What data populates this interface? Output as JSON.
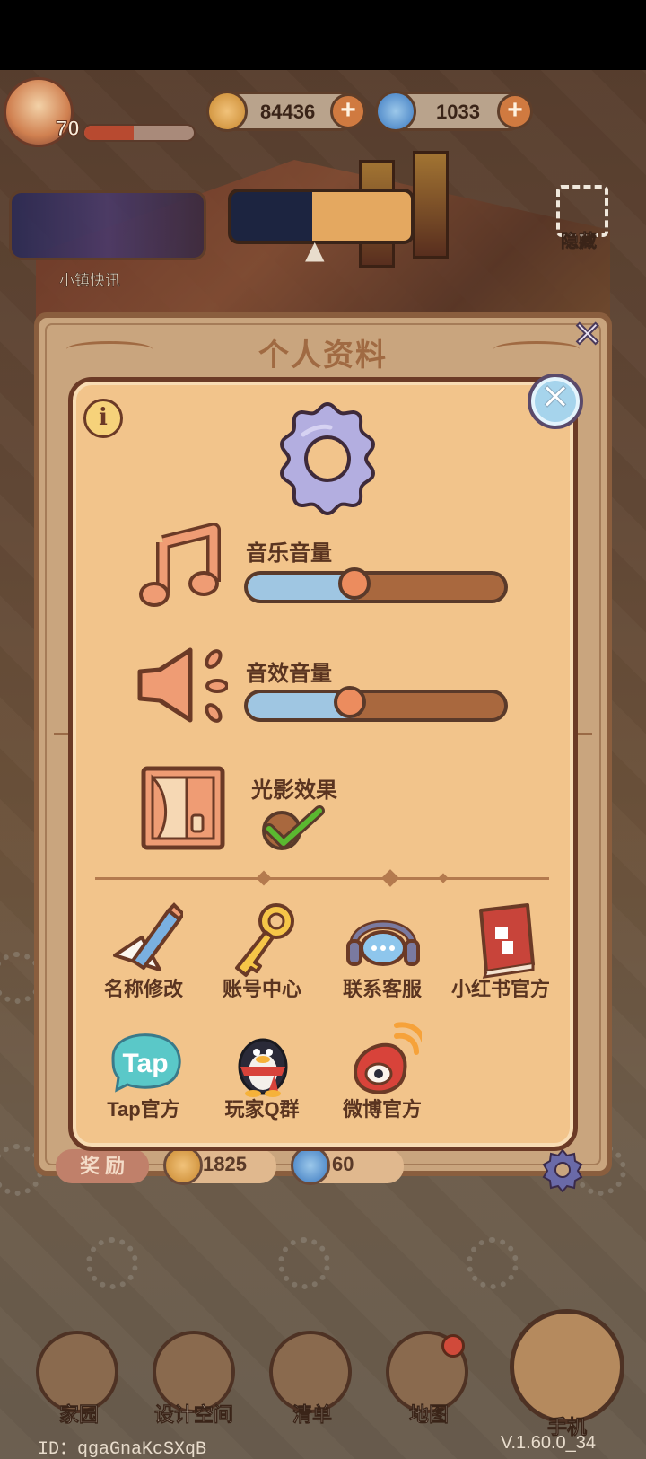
{
  "hud": {
    "level": "70",
    "xp_fraction": 0.45,
    "coins": "84436",
    "gems": "1033",
    "plus_symbol": "+",
    "news_label": "小镇快讯",
    "hide_label": "隐藏"
  },
  "profile_panel": {
    "title": "个人资料",
    "close_symbol": "✕",
    "reward_label": "奖 励",
    "reward_coins": "1825",
    "reward_gems": "60"
  },
  "settings": {
    "info_symbol": "i",
    "close_symbol": "✕",
    "music_label": "音乐音量",
    "music_volume": 0.42,
    "sfx_label": "音效音量",
    "sfx_volume": 0.4,
    "lighting_label": "光影效果",
    "lighting_enabled": true,
    "actions": [
      {
        "label": "名称修改",
        "icon": "pencil-icon"
      },
      {
        "label": "账号中心",
        "icon": "key-icon"
      },
      {
        "label": "联系客服",
        "icon": "headset-icon"
      },
      {
        "label": "小红书官方",
        "icon": "red-book-icon"
      },
      {
        "label": "Tap官方",
        "icon": "tap-logo-icon"
      },
      {
        "label": "玩家Q群",
        "icon": "qq-penguin-icon"
      },
      {
        "label": "微博官方",
        "icon": "weibo-icon"
      }
    ],
    "tap_logo_text": "Tap"
  },
  "nav": {
    "items": [
      "家园",
      "设计空间",
      "清单",
      "地图"
    ],
    "phone_label": "手机"
  },
  "footer": {
    "id_text": "ID：qgaGnaKcSXqB",
    "version": "V.1.60.0_34"
  },
  "colors": {
    "modal_bg": "#f2c48b",
    "border": "#6b3a26",
    "slider_fill": "#9fc6e2",
    "slider_knob": "#ec8c5e",
    "check_green": "#5ab830"
  }
}
